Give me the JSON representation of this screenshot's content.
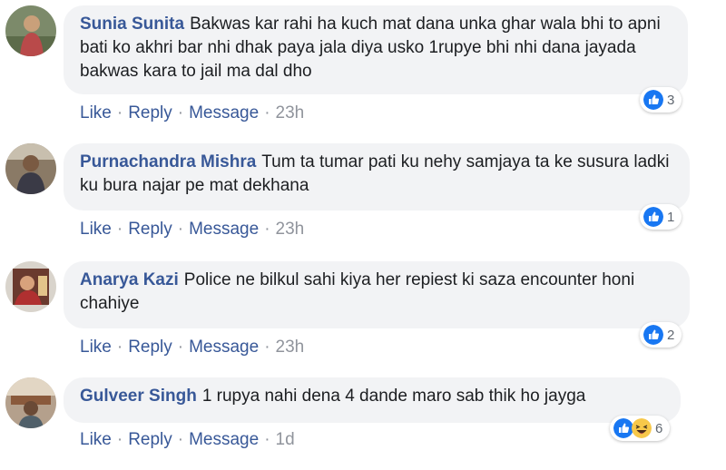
{
  "colors": {
    "link": "#385898",
    "meta": "#90949c",
    "bubble": "#f2f3f5",
    "like_blue": "#1877f2",
    "haha_yellow": "#f7c84a"
  },
  "comments": [
    {
      "author": "Sunia Sunita",
      "text": "Bakwas kar rahi ha kuch mat dana unka ghar wala bhi to apni bati ko akhri bar nhi dhak paya jala diya usko 1rupye bhi nhi dana jayada bakwas kara to jail ma dal dho",
      "actions": {
        "like": "Like",
        "reply": "Reply",
        "message": "Message",
        "time": "23h"
      },
      "reaction_icons": [
        "like-icon"
      ],
      "reaction_count": "3"
    },
    {
      "author": "Purnachandra Mishra",
      "text": "Tum ta tumar pati ku nehy samjaya ta ke susura ladki ku bura najar pe mat dekhana",
      "actions": {
        "like": "Like",
        "reply": "Reply",
        "message": "Message",
        "time": "23h"
      },
      "reaction_icons": [
        "like-icon"
      ],
      "reaction_count": "1"
    },
    {
      "author": "Anarya Kazi",
      "text": "Police ne bilkul sahi kiya her repiest ki saza encounter honi chahiye",
      "actions": {
        "like": "Like",
        "reply": "Reply",
        "message": "Message",
        "time": "23h"
      },
      "reaction_icons": [
        "like-icon"
      ],
      "reaction_count": "2"
    },
    {
      "author": "Gulveer Singh",
      "text": "1 rupya nahi dena 4 dande maro sab thik ho jayga",
      "actions": {
        "like": "Like",
        "reply": "Reply",
        "message": "Message",
        "time": "1d"
      },
      "reaction_icons": [
        "like-icon",
        "haha-icon"
      ],
      "reaction_count": "6"
    }
  ]
}
